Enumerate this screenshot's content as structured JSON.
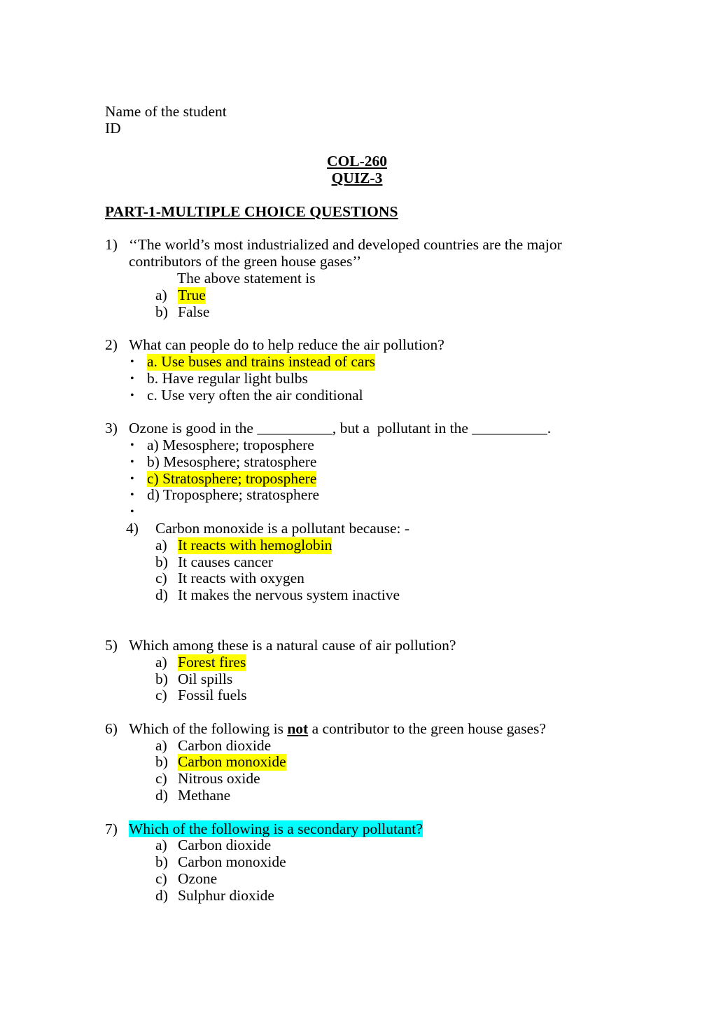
{
  "document": {
    "header": {
      "student_name_label": "Name of the student",
      "id_label": "ID",
      "course_code": "COL-260",
      "quiz_title": "QUIZ-3",
      "part_heading": "PART-1-MULTIPLE CHOICE QUESTIONS"
    },
    "questions": [
      {
        "number": "1)",
        "text": "‘‘The world’s most industrialized and developed countries are the major contributors of the green house gases’’",
        "sub_prompt": "The above statement is",
        "list_style": "lettered",
        "options": [
          {
            "marker": "a)",
            "text": "True",
            "highlight": "yellow"
          },
          {
            "marker": "b)",
            "text": "False",
            "highlight": "none"
          }
        ]
      },
      {
        "number": "2)",
        "text": "What can people do to help reduce the air pollution?",
        "list_style": "bulleted",
        "options": [
          {
            "marker": "•",
            "text": "a. Use buses and trains instead of cars",
            "highlight": "yellow"
          },
          {
            "marker": "•",
            "text": "b. Have regular light bulbs",
            "highlight": "none"
          },
          {
            "marker": "•",
            "text": "c. Use very often the air conditional",
            "highlight": "none"
          }
        ]
      },
      {
        "number": "3)",
        "text": "Ozone is good in the __________, but a  pollutant in the __________.",
        "list_style": "bulleted",
        "options": [
          {
            "marker": "•",
            "text": "a) Mesosphere; troposphere",
            "highlight": "none"
          },
          {
            "marker": "•",
            "text": "b) Mesosphere; stratosphere",
            "highlight": "none"
          },
          {
            "marker": "•",
            "text": "c) Stratosphere; troposphere",
            "highlight": "yellow"
          },
          {
            "marker": "•",
            "text": "d) Troposphere; stratosphere",
            "highlight": "none"
          },
          {
            "marker": "•",
            "text": "",
            "highlight": "none"
          }
        ]
      },
      {
        "number": "4)",
        "text": "Carbon monoxide is a pollutant because: -",
        "list_style": "lettered",
        "options": [
          {
            "marker": "a)",
            "text": "It reacts with hemoglobin",
            "highlight": "yellow"
          },
          {
            "marker": "b)",
            "text": "It causes cancer",
            "highlight": "none"
          },
          {
            "marker": "c)",
            "text": "It reacts with oxygen",
            "highlight": "none"
          },
          {
            "marker": "d)",
            "text": "It makes the nervous system inactive",
            "highlight": "none"
          }
        ]
      },
      {
        "number": "5)",
        "text": "Which among these is a natural cause of air pollution?",
        "list_style": "lettered",
        "options": [
          {
            "marker": "a)",
            "text": "Forest fires",
            "highlight": "yellow"
          },
          {
            "marker": "b)",
            "text": "Oil spills",
            "highlight": "none"
          },
          {
            "marker": "c)",
            "text": "Fossil fuels",
            "highlight": "none"
          }
        ]
      },
      {
        "number": "6)",
        "text_before_emphasis": "Which of the following is ",
        "emphasis": "not",
        "text_after_emphasis": " a contributor to the green house gases?",
        "list_style": "lettered",
        "options": [
          {
            "marker": "a)",
            "text": "Carbon dioxide",
            "highlight": "none"
          },
          {
            "marker": "b)",
            "text": "Carbon monoxide",
            "highlight": "yellow"
          },
          {
            "marker": "c)",
            "text": "Nitrous oxide",
            "highlight": "none"
          },
          {
            "marker": "d)",
            "text": "Methane",
            "highlight": "none"
          }
        ]
      },
      {
        "number": "7)",
        "text": "Which of the following is a secondary pollutant?",
        "highlight": "cyan",
        "list_style": "lettered",
        "options": [
          {
            "marker": "a)",
            "text": "Carbon dioxide",
            "highlight": "none"
          },
          {
            "marker": "b)",
            "text": "Carbon monoxide",
            "highlight": "none"
          },
          {
            "marker": "c)",
            "text": "Ozone",
            "highlight": "none"
          },
          {
            "marker": "d)",
            "text": "Sulphur dioxide",
            "highlight": "none"
          }
        ]
      }
    ],
    "colors": {
      "highlight_yellow": "#FFFF00",
      "highlight_cyan": "#00FFFF",
      "text": "#000000",
      "page_background": "#FFFFFF"
    }
  }
}
